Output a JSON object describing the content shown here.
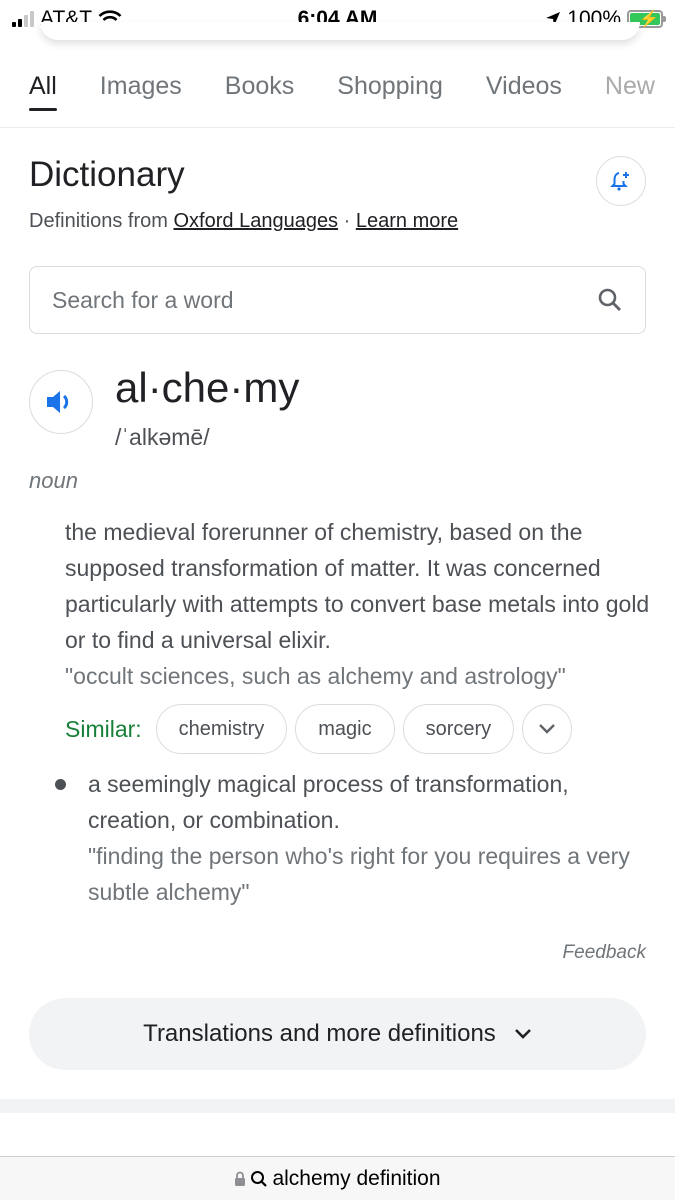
{
  "status_bar": {
    "carrier": "AT&T",
    "time": "6:04 AM",
    "battery": "100%",
    "icons": [
      "signal-icon",
      "wifi-icon",
      "location-arrow-icon",
      "battery-charging-icon"
    ]
  },
  "tabs": [
    {
      "label": "All",
      "active": true
    },
    {
      "label": "Images"
    },
    {
      "label": "Books"
    },
    {
      "label": "Shopping"
    },
    {
      "label": "Videos"
    },
    {
      "label": "New"
    }
  ],
  "dictionary": {
    "title": "Dictionary",
    "source_prefix": "Definitions from",
    "source_link": "Oxford Languages",
    "separator": "·",
    "learn_more": "Learn more",
    "search_placeholder": "Search for a word",
    "headword": "al·che·my",
    "phonetic": "/ˈalkəmē/",
    "part_of_speech": "noun",
    "definitions": [
      {
        "text": "the medieval forerunner of chemistry, based on the supposed transformation of matter. It was concerned particularly with attempts to convert base metals into gold or to find a universal elixir.",
        "example": "\"occult sciences, such as alchemy and astrology\""
      },
      {
        "text": "a seemingly magical process of transformation, creation, or combination.",
        "example": "\"finding the person who's right for you requires a very subtle alchemy\""
      }
    ],
    "similar_label": "Similar:",
    "similar": [
      "chemistry",
      "magic",
      "sorcery"
    ],
    "feedback": "Feedback",
    "more_button": "Translations and more definitions"
  },
  "url_bar": {
    "text": "alchemy definition"
  },
  "colors": {
    "accent_blue": "#1a73e8",
    "similar_green": "#188038",
    "battery_green": "#34c759"
  }
}
